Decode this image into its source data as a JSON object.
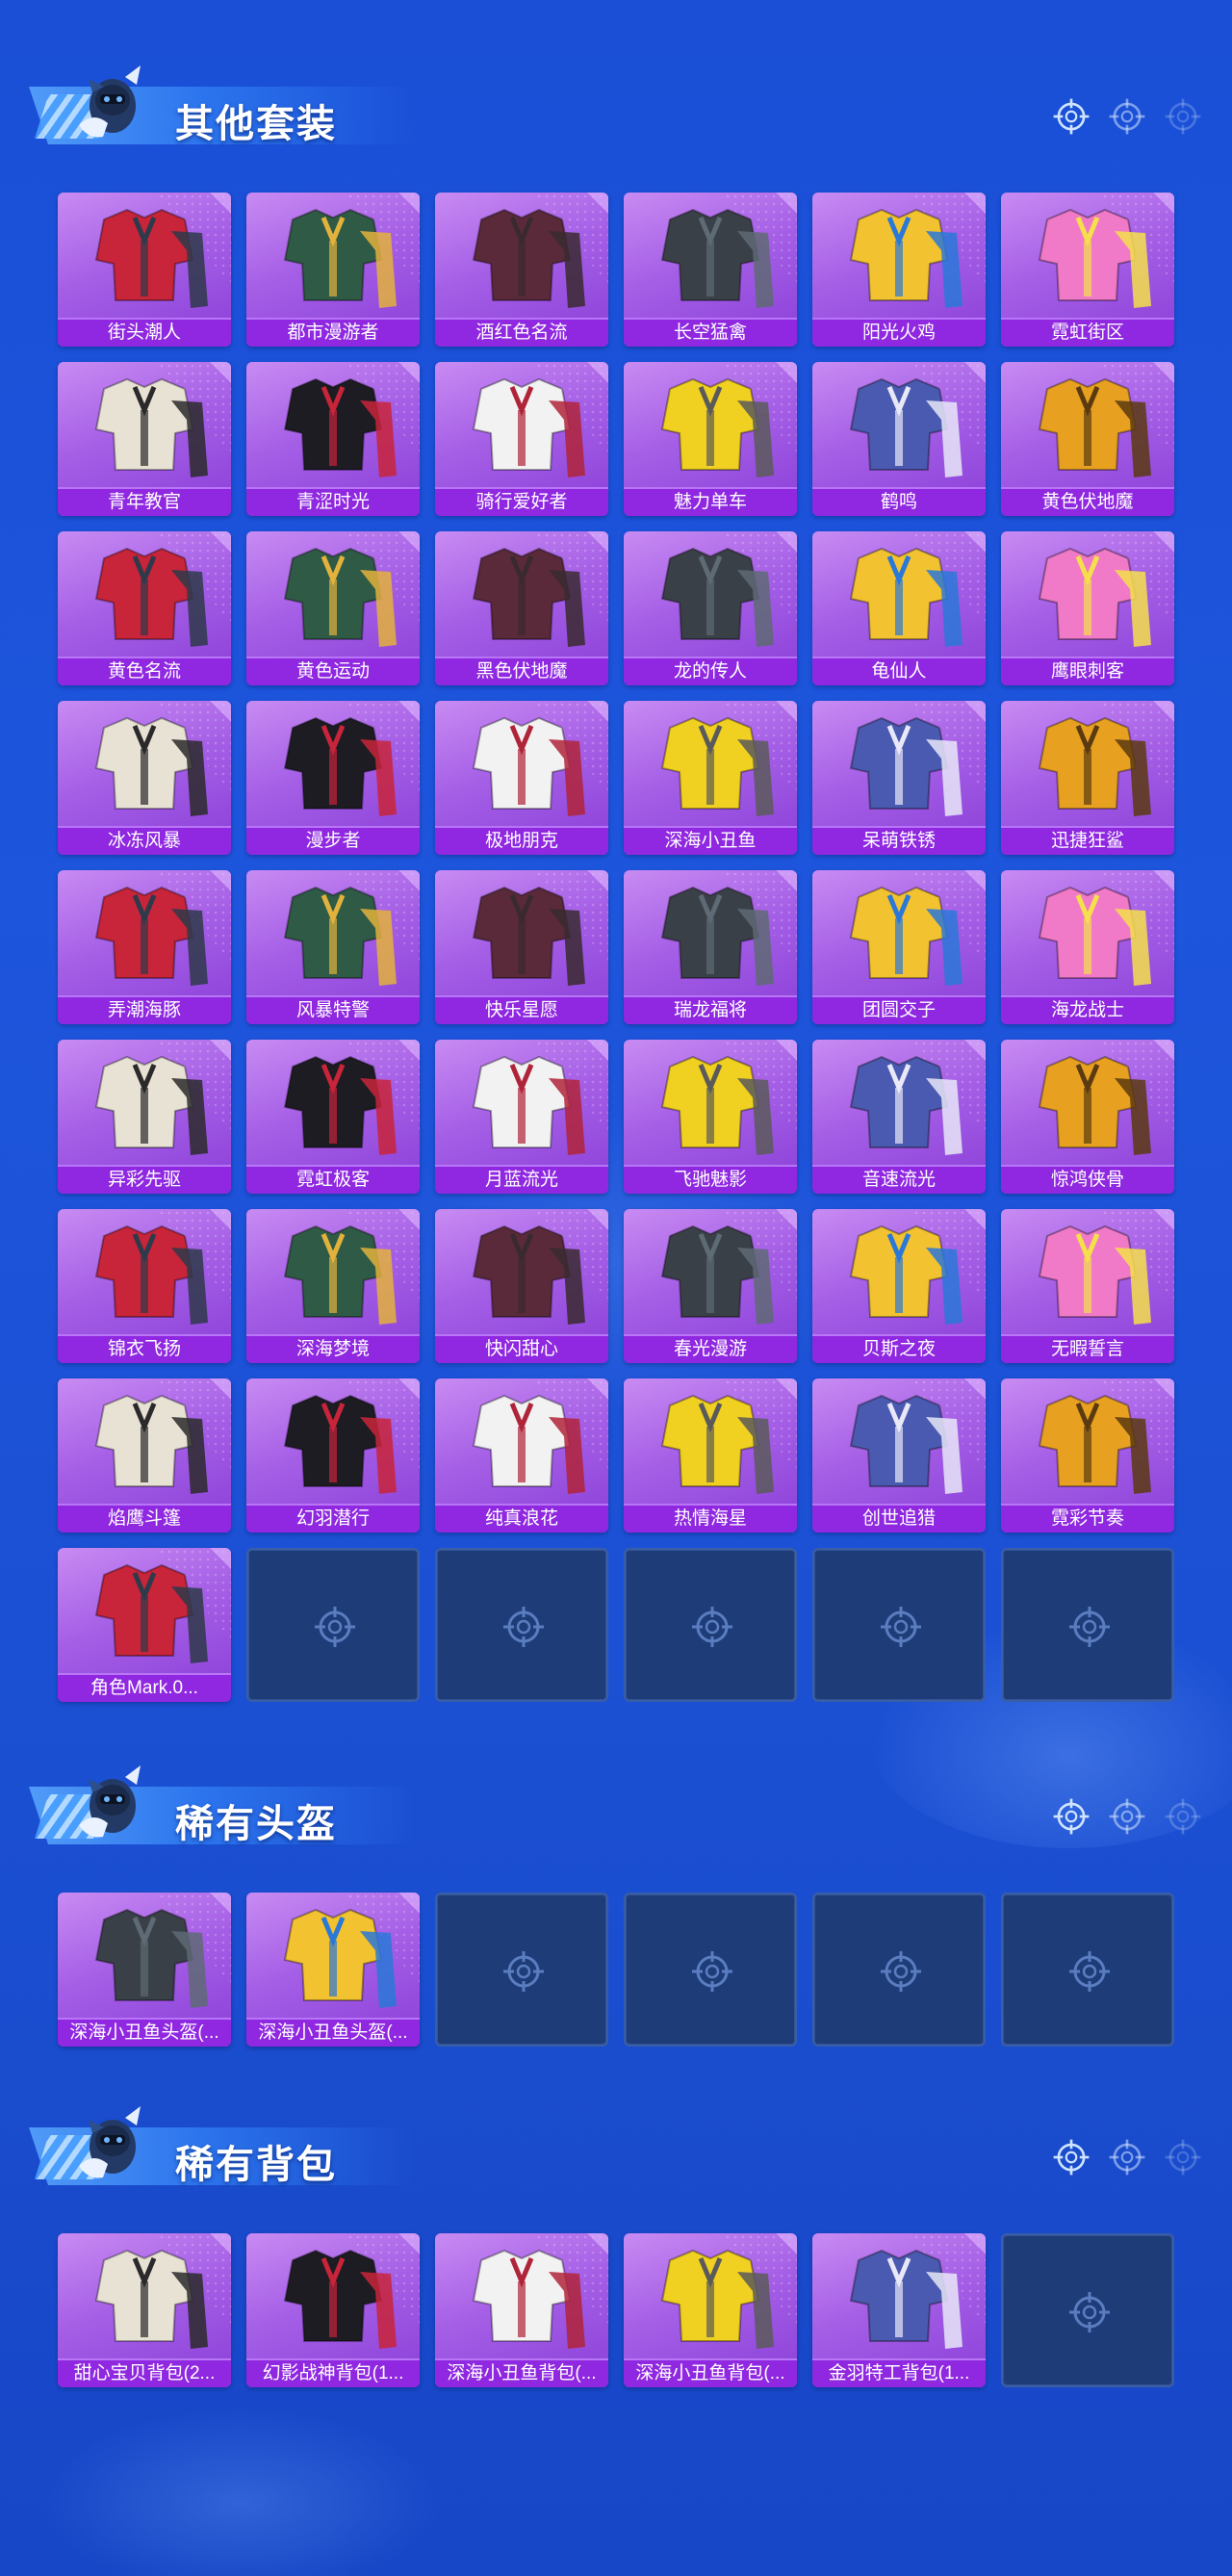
{
  "colors": {
    "background": "#1d55dc",
    "card_top": "#c88bf2",
    "card_bottom": "#8a3fd8",
    "card_label": "#8f28e0",
    "empty_slot": "#1e3c78"
  },
  "sections": [
    {
      "title": "其他套装",
      "items": [
        "街头潮人",
        "都市漫游者",
        "酒红色名流",
        "长空猛禽",
        "阳光火鸡",
        "霓虹街区",
        "青年教官",
        "青涩时光",
        "骑行爱好者",
        "魅力单车",
        "鹤鸣",
        "黄色伏地魔",
        "黄色名流",
        "黄色运动",
        "黑色伏地魔",
        "龙的传人",
        "龟仙人",
        "鹰眼刺客",
        "冰冻风暴",
        "漫步者",
        "极地朋克",
        "深海小丑鱼",
        "呆萌铁锈",
        "迅捷狂鲨",
        "弄潮海豚",
        "风暴特警",
        "快乐星愿",
        "瑞龙福将",
        "团圆交子",
        "海龙战士",
        "异彩先驱",
        "霓虹极客",
        "月蓝流光",
        "飞驰魅影",
        "音速流光",
        "惊鸿侠骨",
        "锦衣飞扬",
        "深海梦境",
        "快闪甜心",
        "春光漫游",
        "贝斯之夜",
        "无暇誓言",
        "焰鹰斗篷",
        "幻羽潜行",
        "纯真浪花",
        "热情海星",
        "创世追猎",
        "霓彩节奏",
        "角色Mark.0..."
      ],
      "empty_slots": 5
    },
    {
      "title": "稀有头盔",
      "items": [
        "深海小丑鱼头盔(...",
        "深海小丑鱼头盔(..."
      ],
      "empty_slots": 4
    },
    {
      "title": "稀有背包",
      "items": [
        "甜心宝贝背包(2...",
        "幻影战神背包(1...",
        "深海小丑鱼背包(...",
        "深海小丑鱼背包(...",
        "金羽特工背包(1..."
      ],
      "empty_slots": 1
    }
  ]
}
